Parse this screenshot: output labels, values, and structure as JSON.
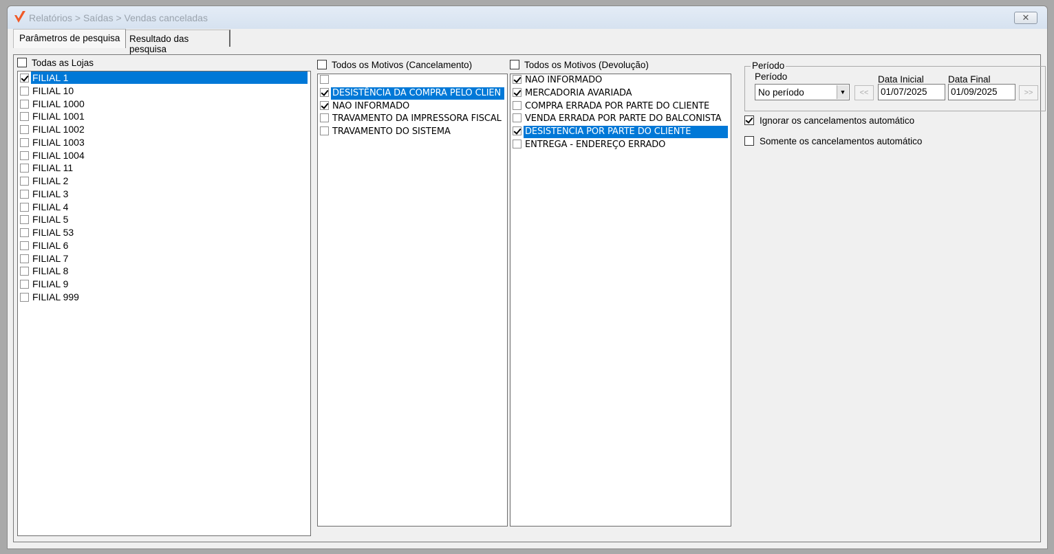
{
  "window": {
    "title": "Relatórios > Saídas > Vendas canceladas",
    "close_label": "✕"
  },
  "tabs": [
    {
      "label": "Parâmetros de pesquisa",
      "active": true
    },
    {
      "label": "Resultado das pesquisa",
      "active": false
    }
  ],
  "lojas": {
    "header": "Todas as Lojas",
    "all_checked": false,
    "items": [
      {
        "label": "FILIAL 1",
        "checked": true,
        "selected": true
      },
      {
        "label": "FILIAL 10",
        "checked": false
      },
      {
        "label": "FILIAL 1000",
        "checked": false
      },
      {
        "label": "FILIAL 1001",
        "checked": false
      },
      {
        "label": "FILIAL 1002",
        "checked": false
      },
      {
        "label": "FILIAL 1003",
        "checked": false
      },
      {
        "label": "FILIAL 1004",
        "checked": false
      },
      {
        "label": "FILIAL 11",
        "checked": false
      },
      {
        "label": "FILIAL 2",
        "checked": false
      },
      {
        "label": "FILIAL 3",
        "checked": false
      },
      {
        "label": "FILIAL 4",
        "checked": false
      },
      {
        "label": "FILIAL 5",
        "checked": false
      },
      {
        "label": "FILIAL 53",
        "checked": false
      },
      {
        "label": "FILIAL 6",
        "checked": false
      },
      {
        "label": "FILIAL 7",
        "checked": false
      },
      {
        "label": "FILIAL 8",
        "checked": false
      },
      {
        "label": "FILIAL 9",
        "checked": false
      },
      {
        "label": "FILIAL 999",
        "checked": false
      }
    ]
  },
  "cancelamento": {
    "header": "Todos os Motivos (Cancelamento)",
    "all_checked": false,
    "items": [
      {
        "label": "",
        "checked": false
      },
      {
        "label": "DESISTÊNCIA DA COMPRA PELO CLIEN",
        "checked": true,
        "selected": true
      },
      {
        "label": "NAO INFORMADO",
        "checked": true
      },
      {
        "label": "TRAVAMENTO DA IMPRESSORA FISCAL",
        "checked": false
      },
      {
        "label": "TRAVAMENTO DO SISTEMA",
        "checked": false
      }
    ]
  },
  "devolucao": {
    "header": "Todos os Motivos (Devolução)",
    "all_checked": false,
    "items": [
      {
        "label": "NAO INFORMADO",
        "checked": true
      },
      {
        "label": "MERCADORIA AVARIADA",
        "checked": true
      },
      {
        "label": "COMPRA ERRADA POR PARTE DO CLIENTE",
        "checked": false
      },
      {
        "label": "VENDA ERRADA POR PARTE DO BALCONISTA",
        "checked": false
      },
      {
        "label": "DESISTENCIA POR PARTE DO CLIENTE",
        "checked": true,
        "selected": true
      },
      {
        "label": "ENTREGA - ENDEREÇO ERRADO",
        "checked": false
      }
    ]
  },
  "periodo": {
    "group_label": "Período",
    "select_label": "Período",
    "select_value": "No período",
    "prev_label": "<<",
    "next_label": ">>",
    "data_inicial_label": "Data Inicial",
    "data_inicial": "01/07/2025",
    "data_final_label": "Data Final",
    "data_final": "01/09/2025"
  },
  "options": [
    {
      "label": "Ignorar os cancelamentos automático",
      "checked": true
    },
    {
      "label": "Somente os cancelamentos automático",
      "checked": false
    }
  ]
}
